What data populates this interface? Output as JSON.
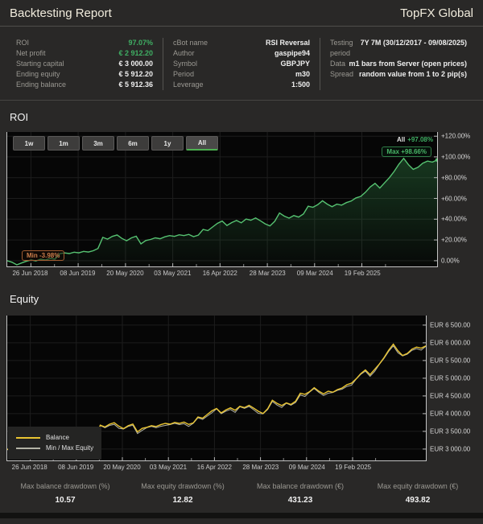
{
  "header": {
    "title": "Backtesting Report",
    "brand": "TopFX Global"
  },
  "stats": {
    "col1": [
      {
        "label": "ROI",
        "value": "97.07%"
      },
      {
        "label": "Net profit",
        "value": "€ 2 912.20"
      },
      {
        "label": "Starting capital",
        "value": "€ 3 000.00"
      },
      {
        "label": "Ending equity",
        "value": "€ 5 912.20"
      },
      {
        "label": "Ending balance",
        "value": "€ 5 912.36"
      }
    ],
    "col2": [
      {
        "label": "cBot name",
        "value": "RSI Reversal"
      },
      {
        "label": "Author",
        "value": "gaspipe94"
      },
      {
        "label": "Symbol",
        "value": "GBPJPY"
      },
      {
        "label": "Period",
        "value": "m30"
      },
      {
        "label": "Leverage",
        "value": "1:500"
      }
    ],
    "col3": [
      {
        "label": "Testing period",
        "value": "7Y 7M (30/12/2017 - 09/08/2025)"
      },
      {
        "label": "Data",
        "value": "m1 bars from Server (open prices)"
      },
      {
        "label": "Spread",
        "value": "random value from 1 to 2 pip(s)"
      }
    ]
  },
  "roi_section": {
    "title": "ROI",
    "range_buttons": [
      "1w",
      "1m",
      "3m",
      "6m",
      "1y",
      "All"
    ],
    "active_button": "All",
    "annotations": {
      "all_label": "All",
      "all_value": "+97.08%",
      "max": "Max +98.66%",
      "min": "Min -3.98%"
    }
  },
  "equity_section": {
    "title": "Equity",
    "legend": [
      "Balance",
      "Min / Max Equity"
    ]
  },
  "footer_stats": [
    {
      "label": "Max balance drawdown (%)",
      "value": "10.57"
    },
    {
      "label": "Max equity drawdown (%)",
      "value": "12.82"
    },
    {
      "label": "Max balance drawdown (€)",
      "value": "431.23"
    },
    {
      "label": "Max equity drawdown (€)",
      "value": "493.82"
    }
  ],
  "colors": {
    "accent_green": "#3fae63",
    "roi_line": "#56c271",
    "balance_yellow": "#e9c431",
    "minmax_grey": "#b3b3a6",
    "min_orange": "#cd7f4c",
    "grid": "#1d1d1d",
    "axis": "#c4c4c4",
    "plot_bg": "#060606"
  },
  "chart_data": [
    {
      "type": "area",
      "title": "ROI",
      "ylabel": "ROI %",
      "x_tick_labels": [
        "26 Jun 2018",
        "08 Jun 2019",
        "20 May 2020",
        "03 May 2021",
        "16 Apr 2022",
        "28 Mar 2023",
        "09 Mar 2024",
        "19 Feb 2025"
      ],
      "x_tick_fractions": [
        0.055,
        0.165,
        0.275,
        0.385,
        0.495,
        0.605,
        0.715,
        0.825
      ],
      "y_tick_values": [
        0,
        20,
        40,
        60,
        80,
        100,
        120
      ],
      "y_tick_labels": [
        "0.00%",
        "+20.00%",
        "+40.00%",
        "+60.00%",
        "+80.00%",
        "+100.00%",
        "+120.00%"
      ],
      "ylim": [
        -5.5,
        124
      ],
      "grid": true,
      "end_marker": true,
      "series": [
        {
          "name": "ROI",
          "color": "#56c271",
          "fill_top": "rgba(62,170,90,0.30)",
          "fill_bottom": "rgba(62,170,90,0.02)",
          "values": [
            0,
            -1.5,
            -3.98,
            -2.2,
            -0.5,
            0.8,
            -0.2,
            1.5,
            0.8,
            2.2,
            1.5,
            6.8,
            7.5,
            6.9,
            8.2,
            7.6,
            9.0,
            8.4,
            9.6,
            11.8,
            22.5,
            20.8,
            23.4,
            24.8,
            21.5,
            19.2,
            22.0,
            23.6,
            16.2,
            19.5,
            20.5,
            22.0,
            21.2,
            23.0,
            24.2,
            23.4,
            25.0,
            24.2,
            25.4,
            23.2,
            24.6,
            30.2,
            29.0,
            32.5,
            36.0,
            38.2,
            34.0,
            36.8,
            38.8,
            36.5,
            40.2,
            39.0,
            41.2,
            38.5,
            35.5,
            33.5,
            38.0,
            46.0,
            43.0,
            41.0,
            43.5,
            42.0,
            45.0,
            52.5,
            51.5,
            54.0,
            57.8,
            54.5,
            52.0,
            54.5,
            53.5,
            56.0,
            57.5,
            60.5,
            62.0,
            66.0,
            71.0,
            74.5,
            70.0,
            75.0,
            80.0,
            86.0,
            93.0,
            98.66,
            92.5,
            88.0,
            90.0,
            94.0,
            96.0,
            95.0,
            97.08
          ]
        }
      ],
      "stats": {
        "all": 97.08,
        "max": 98.66,
        "min": -3.98
      }
    },
    {
      "type": "line",
      "title": "Equity",
      "ylabel": "EUR",
      "x_tick_labels": [
        "26 Jun 2018",
        "08 Jun 2019",
        "20 May 2020",
        "03 May 2021",
        "16 Apr 2022",
        "28 Mar 2023",
        "09 Mar 2024",
        "19 Feb 2025"
      ],
      "x_tick_fractions": [
        0.055,
        0.165,
        0.275,
        0.385,
        0.495,
        0.605,
        0.715,
        0.825
      ],
      "y_tick_values": [
        3000,
        3500,
        4000,
        4500,
        5000,
        5500,
        6000,
        6500
      ],
      "y_tick_labels": [
        "EUR 3 000.00",
        "EUR 3 500.00",
        "EUR 4 000.00",
        "EUR 4 500.00",
        "EUR 5 000.00",
        "EUR 5 500.00",
        "EUR 6 000.00",
        "EUR 6 500.00"
      ],
      "ylim": [
        2680,
        6770
      ],
      "grid": true,
      "legend_position": "bottom-left",
      "series": [
        {
          "name": "Min / Max Equity",
          "color": "#b3b3a6",
          "values": [
            2990,
            2933,
            2847,
            2888,
            2927,
            3014,
            2972,
            3011,
            2978,
            3008,
            3035,
            3182,
            3191,
            3161,
            3188,
            3218,
            3248,
            3218,
            3242,
            3296,
            3665,
            3602,
            3668,
            3698,
            3587,
            3566,
            3638,
            3674,
            3440,
            3527,
            3605,
            3638,
            3602,
            3644,
            3668,
            3692,
            3728,
            3692,
            3716,
            3638,
            3728,
            3884,
            3836,
            3929,
            4022,
            4136,
            3998,
            4070,
            4118,
            4037,
            4196,
            4148,
            4202,
            4109,
            4007,
            3995,
            4118,
            4346,
            4244,
            4172,
            4295,
            4238,
            4316,
            4529,
            4487,
            4610,
            4712,
            4601,
            4514,
            4577,
            4595,
            4658,
            4691,
            4769,
            4802,
            4970,
            5108,
            5201,
            5054,
            5192,
            5390,
            5558,
            5756,
            5914,
            5717,
            5630,
            5678,
            5786,
            5834,
            5792,
            5902
          ]
        },
        {
          "name": "Balance",
          "color": "#e9c431",
          "values": [
            3000,
            2955,
            2881,
            2934,
            2985,
            3024,
            2994,
            3045,
            3024,
            3066,
            3045,
            3204,
            3225,
            3207,
            3246,
            3228,
            3270,
            3252,
            3288,
            3354,
            3675,
            3624,
            3702,
            3744,
            3645,
            3576,
            3660,
            3708,
            3486,
            3585,
            3615,
            3660,
            3636,
            3690,
            3726,
            3702,
            3750,
            3726,
            3762,
            3696,
            3738,
            3906,
            3870,
            3975,
            4080,
            4146,
            4020,
            4104,
            4164,
            4095,
            4206,
            4170,
            4236,
            4155,
            4065,
            4005,
            4140,
            4380,
            4290,
            4230,
            4305,
            4260,
            4350,
            4575,
            4545,
            4620,
            4734,
            4635,
            4560,
            4635,
            4605,
            4680,
            4725,
            4815,
            4860,
            4980,
            5130,
            5235,
            5100,
            5250,
            5400,
            5580,
            5790,
            5960,
            5775,
            5640,
            5700,
            5820,
            5880,
            5850,
            5912
          ]
        }
      ]
    }
  ]
}
